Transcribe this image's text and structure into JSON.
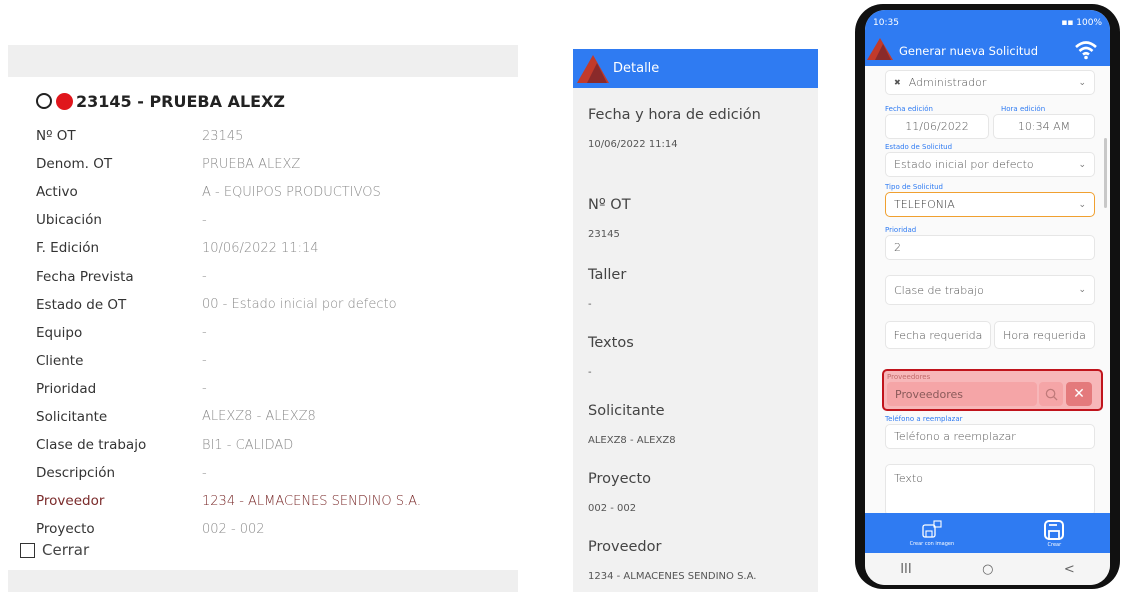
{
  "panel1": {
    "title": "23145 - PRUEBA ALEXZ",
    "rows": [
      {
        "key": "Nº OT",
        "value": "23145"
      },
      {
        "key": "Denom. OT",
        "value": "PRUEBA ALEXZ"
      },
      {
        "key": "Activo",
        "value": "A - EQUIPOS PRODUCTIVOS"
      },
      {
        "key": "Ubicación",
        "value": "-"
      },
      {
        "key": "F. Edición",
        "value": "10/06/2022 11:14"
      },
      {
        "key": "Fecha Prevista",
        "value": "-"
      },
      {
        "key": "Estado de OT",
        "value": "00 - Estado inicial por defecto"
      },
      {
        "key": "Equipo",
        "value": "-"
      },
      {
        "key": "Cliente",
        "value": "-"
      },
      {
        "key": "Prioridad",
        "value": "-"
      },
      {
        "key": "Solicitante",
        "value": "ALEXZ8 - ALEXZ8"
      },
      {
        "key": "Clase de trabajo",
        "value": "BI1 - CALIDAD"
      },
      {
        "key": "Descripción",
        "value": "-"
      },
      {
        "key": "Proveedor",
        "value": "1234 - ALMACENES SENDINO S.A."
      },
      {
        "key": "Proyecto",
        "value": "002 - 002"
      }
    ],
    "close_label": "Cerrar"
  },
  "panel2": {
    "header_title": "Detalle",
    "fields": [
      {
        "label": "Fecha y hora de edición",
        "value": "10/06/2022 11:14"
      },
      {
        "label": "Nº OT",
        "value": "23145"
      },
      {
        "label": "Taller",
        "value": "-"
      },
      {
        "label": "Textos",
        "value": "-"
      },
      {
        "label": "Solicitante",
        "value": "ALEXZ8 - ALEXZ8"
      },
      {
        "label": "Proyecto",
        "value": "002 - 002"
      },
      {
        "label": "Proveedor",
        "value": "1234 - ALMACENES SENDINO S.A."
      }
    ]
  },
  "panel3": {
    "status_time": "10:35",
    "status_right": "100%",
    "app_title": "Generar nueva Solicitud",
    "user_select": "Administrador",
    "fecha_edicion_label": "Fecha edición",
    "fecha_edicion": "11/06/2022",
    "hora_edicion_label": "Hora edición",
    "hora_edicion": "10:34 AM",
    "estado_label": "Estado de Solicitud",
    "estado_value": "Estado inicial por defecto",
    "tipo_label": "Tipo de Solicitud",
    "tipo_value": "TELEFONIA",
    "prioridad_label": "Prioridad",
    "prioridad_value": "2",
    "clase_placeholder": "Clase de trabajo",
    "fecha_req_placeholder": "Fecha requerida",
    "hora_req_placeholder": "Hora requerida",
    "proveedores_label": "Proveedores",
    "proveedores_placeholder": "Proveedores",
    "telefono_label": "Teléfono a reemplazar",
    "telefono_placeholder": "Teléfono a reemplazar",
    "texto_placeholder": "Texto",
    "action_image_caption": "Crear con imagen",
    "action_create_caption": "Crear",
    "nav": [
      "III",
      "○",
      "<"
    ]
  }
}
